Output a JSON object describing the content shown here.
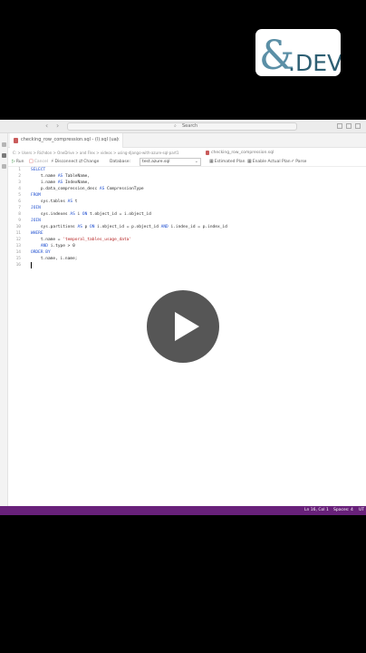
{
  "logo": {
    "ampersand": "&",
    "text": ".DEV"
  },
  "titlebar": {
    "search_label": "Search",
    "search_icon": "search-icon"
  },
  "tab": {
    "label": "checking_row_compression.sql - (l).sql (ua)",
    "close": "×"
  },
  "breadcrumb": "C: > Users > Richdon > OneDrive > and Flex > videos > using-django-with-azure-sql-part1",
  "split_tab": {
    "label": "checking_row_compression.sql"
  },
  "toolbar": {
    "run": "Run",
    "cancel": "Cancel",
    "disconnect": "Disconnect",
    "change": "Change",
    "database_label": "Database:",
    "database_value": "test.azure.sql",
    "estimated_plan": "Estimated Plan",
    "actual_plan": "Enable Actual Plan",
    "parse": "Parse"
  },
  "code": [
    {
      "n": "1",
      "t": "SELECT"
    },
    {
      "n": "2",
      "t": "    t.name AS TableName,"
    },
    {
      "n": "3",
      "t": "    i.name AS IndexName,"
    },
    {
      "n": "4",
      "t": "    p.data_compression_desc AS CompressionType"
    },
    {
      "n": "5",
      "t": "FROM"
    },
    {
      "n": "6",
      "t": "    sys.tables AS t"
    },
    {
      "n": "7",
      "t": "JOIN"
    },
    {
      "n": "8",
      "t": "    sys.indexes AS i ON t.object_id = i.object_id"
    },
    {
      "n": "9",
      "t": "JOIN"
    },
    {
      "n": "10",
      "t": "    sys.partitions AS p ON i.object_id = p.object_id AND i.index_id = p.index_id"
    },
    {
      "n": "11",
      "t": "WHERE"
    },
    {
      "n": "12",
      "t": "    t.name = 'temporal_tables_usage_data'"
    },
    {
      "n": "13",
      "t": "    AND i.type > 0"
    },
    {
      "n": "14",
      "t": "ORDER BY"
    },
    {
      "n": "15",
      "t": "    t.name, i.name;"
    },
    {
      "n": "16",
      "t": ""
    }
  ],
  "statusbar": {
    "position": "Ln 16, Col 1",
    "spaces": "Spaces: 4",
    "encoding": "UT"
  },
  "colors": {
    "status_bar": "#68217a",
    "keyword": "#1f4fd0",
    "string": "#b31b1b",
    "play_bg": "#484848"
  }
}
